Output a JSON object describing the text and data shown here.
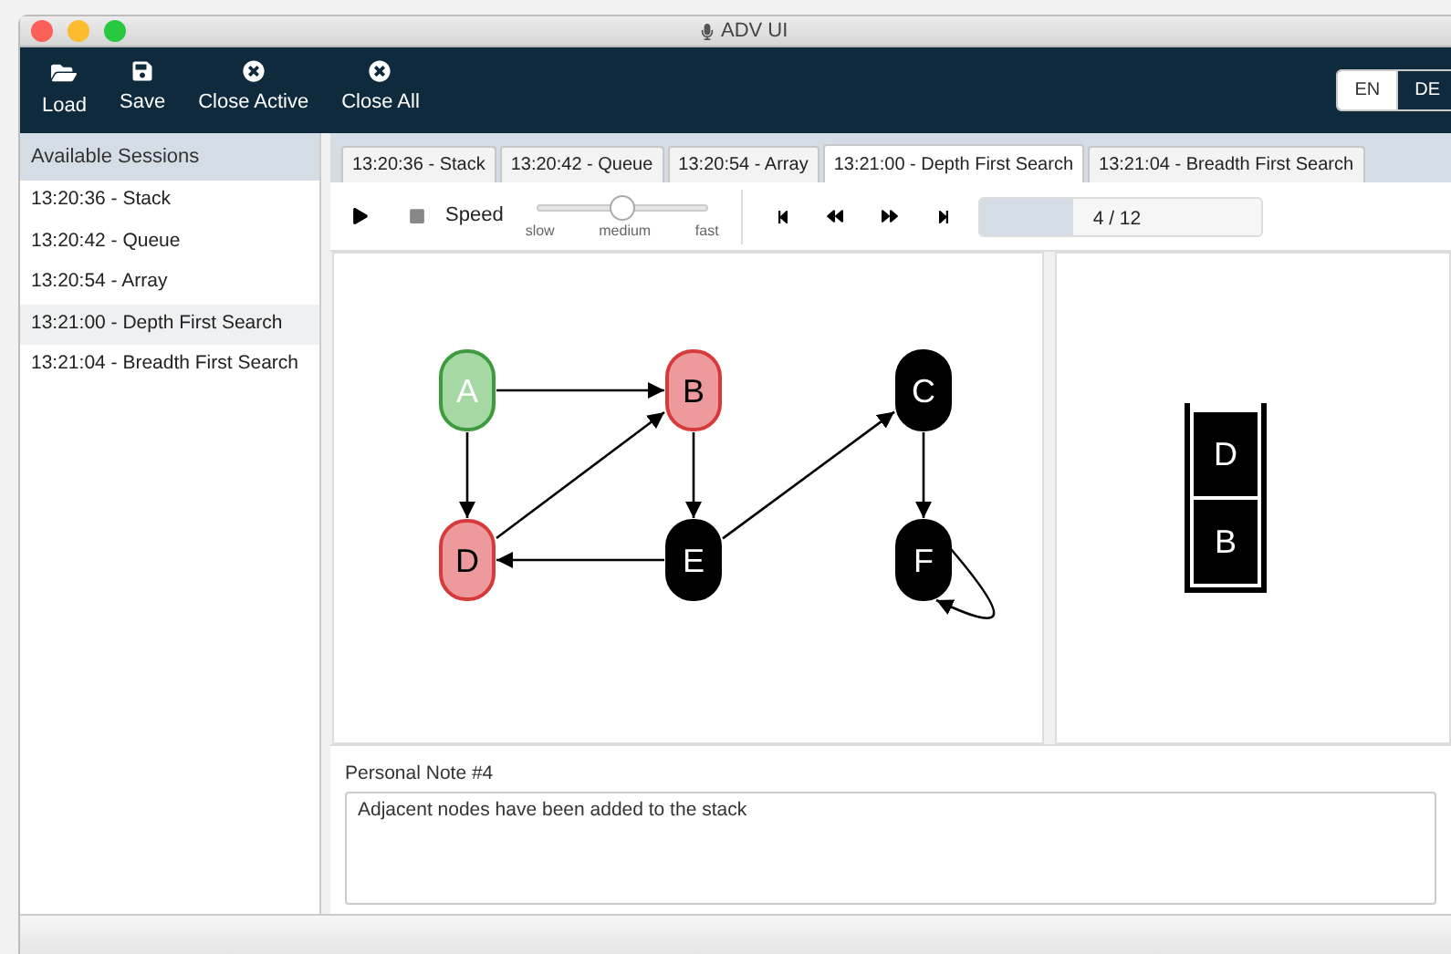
{
  "window": {
    "title": "ADV UI"
  },
  "toolbar": [
    {
      "label": "Load",
      "kind": "load"
    },
    {
      "label": "Save",
      "kind": "save"
    },
    {
      "label": "Close Active",
      "kind": "close"
    },
    {
      "label": "Close All",
      "kind": "close"
    }
  ],
  "languages": [
    {
      "label": "EN",
      "selected": true
    },
    {
      "label": "DE",
      "selected": false
    }
  ],
  "sidebar": {
    "title": "Available Sessions",
    "items": [
      {
        "label": "13:20:36 - Stack",
        "selected": false
      },
      {
        "label": "13:20:42 - Queue",
        "selected": false
      },
      {
        "label": "13:20:54 - Array",
        "selected": false
      },
      {
        "label": "13:21:00 - Depth First Search",
        "selected": true
      },
      {
        "label": "13:21:04 - Breadth First Search",
        "selected": false
      }
    ]
  },
  "tabs": [
    {
      "label": "13:20:36 - Stack",
      "selected": false
    },
    {
      "label": "13:20:42 - Queue",
      "selected": false
    },
    {
      "label": "13:20:54 - Array",
      "selected": false
    },
    {
      "label": "13:21:00 - Depth First Search",
      "selected": true
    },
    {
      "label": "13:21:04 - Breadth First Search",
      "selected": false
    }
  ],
  "player": {
    "speed_label": "Speed",
    "speed": {
      "level": 0.5,
      "ticks": [
        "slow",
        "medium",
        "fast"
      ]
    },
    "progress": {
      "level": 0.33,
      "reading": "4 / 12"
    }
  },
  "graph": {
    "nodes": [
      {
        "label": "A",
        "visited": true,
        "in_stack": false
      },
      {
        "label": "B",
        "visited": false,
        "in_stack": true
      },
      {
        "label": "C",
        "visited": false,
        "in_stack": false
      },
      {
        "label": "D",
        "visited": false,
        "in_stack": true
      },
      {
        "label": "E",
        "visited": false,
        "in_stack": false
      },
      {
        "label": "F",
        "visited": false,
        "in_stack": false
      }
    ]
  },
  "stack": {
    "items": [
      "D",
      "B"
    ]
  },
  "note": {
    "label": "Personal Note #4",
    "value": "Adjacent nodes have been added to the stack"
  }
}
